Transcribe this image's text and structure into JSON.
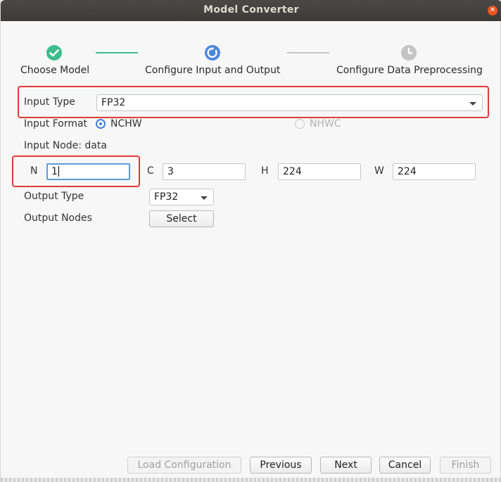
{
  "window": {
    "title": "Model Converter",
    "close_glyph": "✕"
  },
  "steps": [
    {
      "label": "Choose Model",
      "icon": "check-circle-icon",
      "state": "completed",
      "color": "#3dbd8f"
    },
    {
      "label": "Configure Input and Output",
      "icon": "progress-circle-icon",
      "state": "active",
      "color": "#4a86e0"
    },
    {
      "label": "Configure Data Preprocessing",
      "icon": "clock-icon",
      "state": "pending",
      "color": "#c4c4c4"
    }
  ],
  "connectors": {
    "done_color": "#3dbd8f",
    "pending_color": "#c8c8c8"
  },
  "input_type": {
    "label": "Input Type",
    "value": "FP32"
  },
  "input_format": {
    "label": "Input Format",
    "options": [
      {
        "label": "NCHW",
        "selected": true,
        "enabled": true
      },
      {
        "label": "NHWC",
        "selected": false,
        "enabled": false
      }
    ]
  },
  "input_node": {
    "label": "Input Node: data"
  },
  "dims": [
    {
      "label": "N",
      "value": "1"
    },
    {
      "label": "C",
      "value": "3"
    },
    {
      "label": "H",
      "value": "224"
    },
    {
      "label": "W",
      "value": "224"
    }
  ],
  "output_type": {
    "label": "Output Type",
    "value": "FP32"
  },
  "output_nodes": {
    "label": "Output Nodes",
    "button": "Select"
  },
  "footer": {
    "load_configuration": "Load Configuration",
    "previous": "Previous",
    "next": "Next",
    "cancel": "Cancel",
    "finish": "Finish"
  },
  "highlight_color": "#e53935"
}
